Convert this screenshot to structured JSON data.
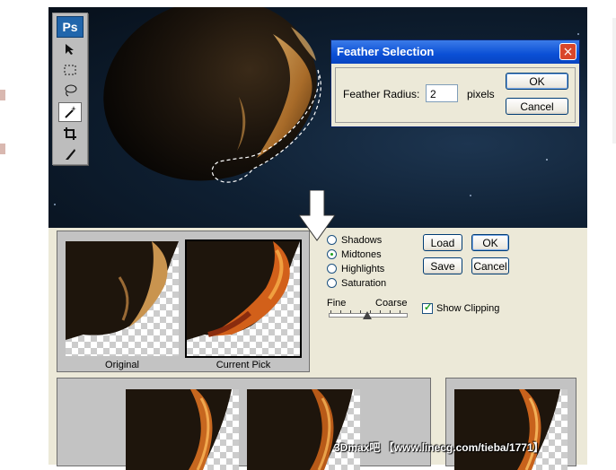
{
  "toolbox": {
    "logo": "Ps",
    "tools": [
      "move-icon",
      "marquee-icon",
      "lasso-icon",
      "magic-wand-icon",
      "crop-icon",
      "slice-icon"
    ]
  },
  "feather_dialog": {
    "title": "Feather Selection",
    "radius_label": "Feather Radius:",
    "radius_value": "2",
    "radius_unit": "pixels",
    "ok_label": "OK",
    "cancel_label": "Cancel",
    "close_glyph": "×"
  },
  "variations": {
    "original_caption": "Original",
    "current_pick_caption": "Current Pick",
    "options": [
      {
        "label": "Shadows",
        "selected": false
      },
      {
        "label": "Midtones",
        "selected": true
      },
      {
        "label": "Highlights",
        "selected": false
      },
      {
        "label": "Saturation",
        "selected": false
      }
    ],
    "fine_label": "Fine",
    "coarse_label": "Coarse",
    "show_clipping_label": "Show Clipping",
    "show_clipping_checked": true,
    "load_label": "Load",
    "ok_label": "OK",
    "save_label": "Save",
    "cancel_label": "Cancel"
  },
  "watermark": "3Dmax吧 【www.linecg.com/tieba/1771】",
  "colors": {
    "dialog_title": "#0a4fd6",
    "panel_bg": "#ece9d8",
    "space_bg": "#0f2033",
    "accent_orange": "#e6851f"
  }
}
